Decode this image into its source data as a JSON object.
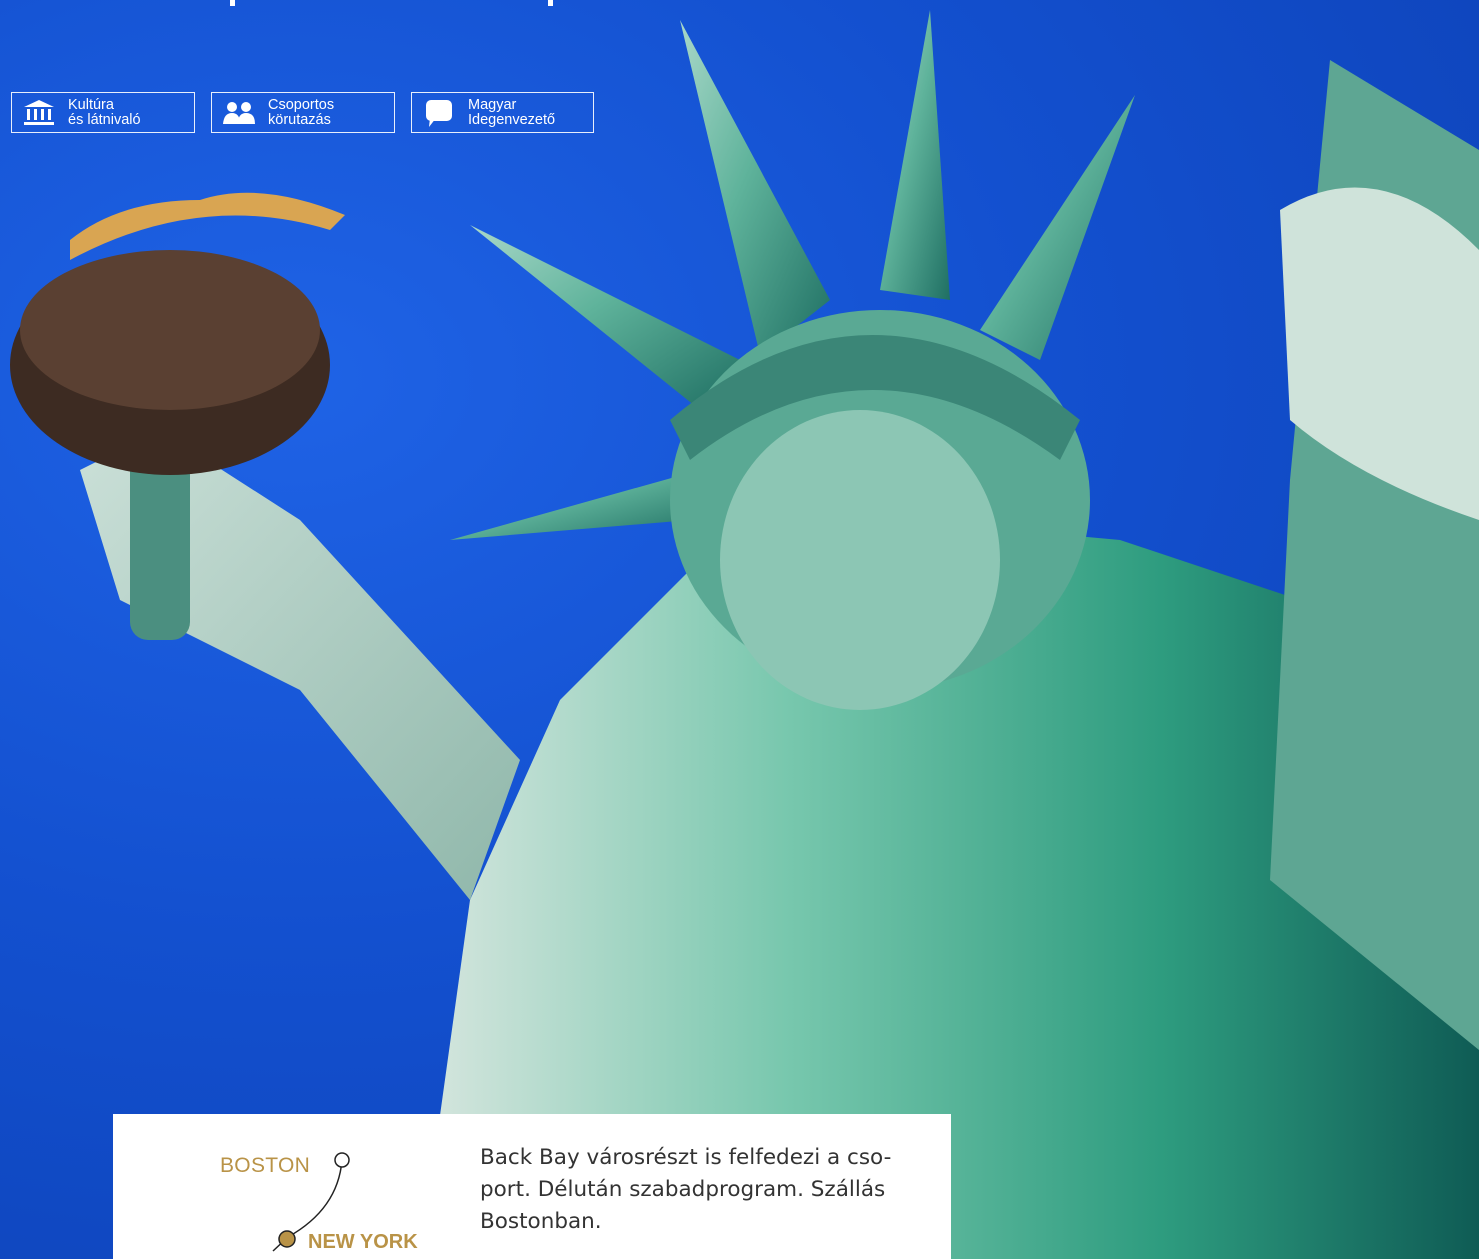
{
  "badges": [
    {
      "icon": "museum-icon",
      "line1": "Kultúra",
      "line2": "és látnivaló"
    },
    {
      "icon": "group-icon",
      "line1": "Csoportos",
      "line2": "körutazás"
    },
    {
      "icon": "speech-bubble-icon",
      "line1": "Magyar",
      "line2": "Idegenvezető"
    }
  ],
  "route": {
    "city_from": "BOSTON",
    "city_to": "NEW YORK"
  },
  "description": {
    "lines": [
      "Back Bay városrészt is felfedezi a cso-",
      "port. Délután szabadprogram. Szállás",
      "Bostonban."
    ]
  },
  "colors": {
    "sky": "#1350cf",
    "statue": "#4fa48c",
    "gold": "#b99347",
    "text": "#333333"
  }
}
